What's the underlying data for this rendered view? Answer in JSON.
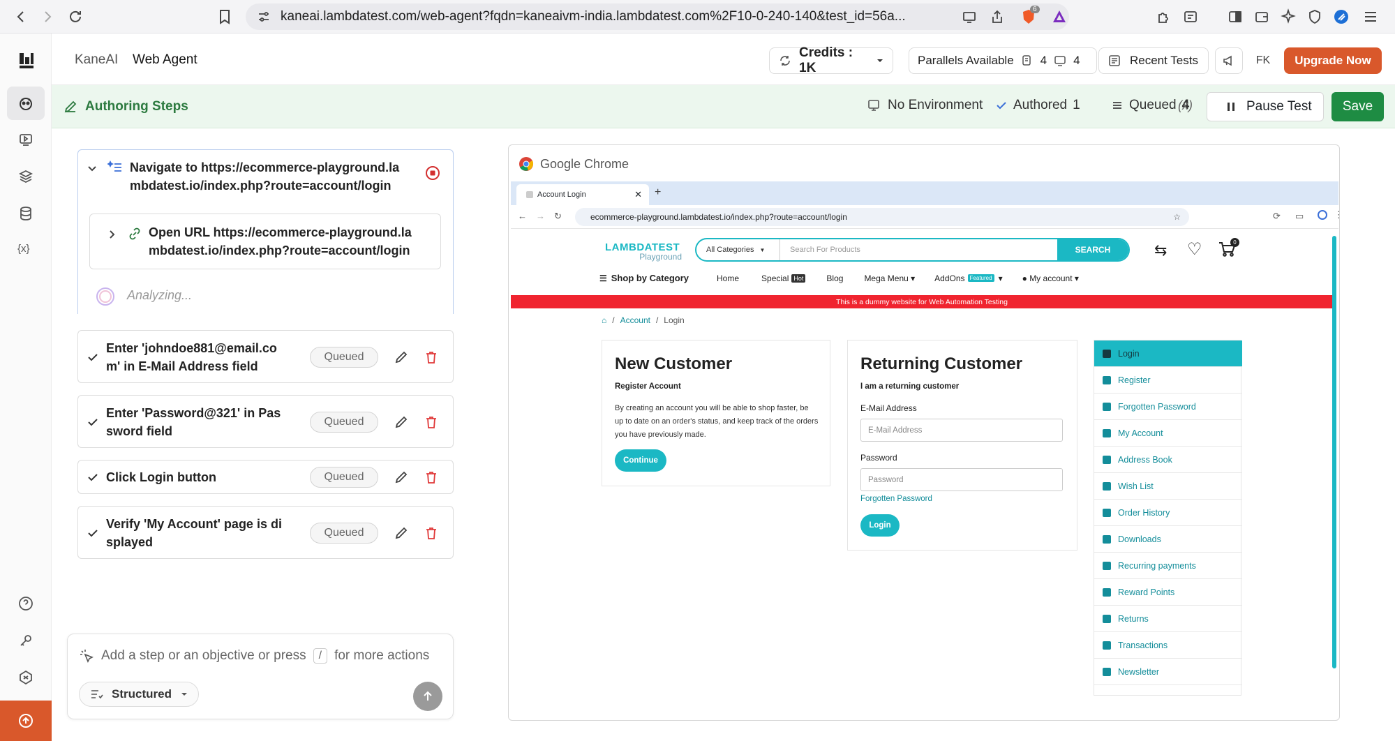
{
  "browser": {
    "url": "kaneai.lambdatest.com/web-agent?fqdn=kaneaivm-india.lambdatest.com%2F10-0-240-140&test_id=56a...",
    "brave_badge": "6"
  },
  "header": {
    "breadcrumb_root": "KaneAI",
    "breadcrumb_current": "Web Agent",
    "credits_label": "Credits : 1K",
    "parallels_label": "Parallels Available",
    "parallels_a": "4",
    "parallels_b": "4",
    "recent_tests": "Recent Tests",
    "avatar_initials": "FK",
    "upgrade_label": "Upgrade Now"
  },
  "authbar": {
    "title": "Authoring Steps",
    "environment": "No Environment",
    "authored_label": "Authored",
    "authored_count": "1",
    "queued_label": "Queued",
    "queued_count": "4",
    "variables_symbol": "(x)",
    "pause_label": "Pause Test",
    "save_label": "Save"
  },
  "steps": {
    "active": {
      "title_line1": "Navigate to https://ecommerce-playground.la",
      "title_line2": "mbdatest.io/index.php?route=account/login",
      "sub_line1": "Open URL https://ecommerce-playground.la",
      "sub_line2": "mbdatest.io/index.php?route=account/login",
      "analyzing": "Analyzing..."
    },
    "queued": [
      {
        "line1": "Enter 'johndoe881@email.co",
        "line2": "m' in E-Mail Address field",
        "status": "Queued"
      },
      {
        "line1": "Enter 'Password@321' in Pas",
        "line2": "sword field",
        "status": "Queued"
      },
      {
        "line1": "Click Login button",
        "line2": "",
        "status": "Queued"
      },
      {
        "line1": "Verify 'My Account' page is di",
        "line2": "splayed",
        "status": "Queued"
      }
    ]
  },
  "chat": {
    "placeholder_a": "Add a step or an objective or press",
    "slash": "/",
    "placeholder_b": "for more actions",
    "mode": "Structured"
  },
  "embed": {
    "window_title": "Google Chrome",
    "tab_title": "Account Login",
    "url": "ecommerce-playground.lambdatest.io/index.php?route=account/login",
    "site": {
      "logo_top": "LAMBDATEST",
      "logo_bottom": "Playground",
      "categories": "All Categories",
      "search_placeholder": "Search For Products",
      "search_button": "SEARCH",
      "cart_count": "0",
      "shop_by_category": "Shop by Category",
      "menu": [
        "Home",
        "Special",
        "Blog",
        "Mega Menu",
        "AddOns",
        "My account"
      ],
      "hot_badge": "Hot",
      "featured_badge": "Featured",
      "banner": "This is a dummy website for Web Automation Testing",
      "breadcrumb": [
        "Account",
        "Login"
      ],
      "new_customer": {
        "title": "New Customer",
        "subtitle": "Register Account",
        "body": "By creating an account you will be able to shop faster, be up to date on an order's status, and keep track of the orders you have previously made.",
        "button": "Continue"
      },
      "returning": {
        "title": "Returning Customer",
        "subtitle": "I am a returning customer",
        "email_label": "E-Mail Address",
        "email_placeholder": "E-Mail Address",
        "password_label": "Password",
        "password_placeholder": "Password",
        "forgotten": "Forgotten Password",
        "button": "Login"
      },
      "side_menu": [
        "Login",
        "Register",
        "Forgotten Password",
        "My Account",
        "Address Book",
        "Wish List",
        "Order History",
        "Downloads",
        "Recurring payments",
        "Reward Points",
        "Returns",
        "Transactions",
        "Newsletter"
      ]
    }
  },
  "colors": {
    "accent_orange": "#d9582b",
    "save_green": "#1e8c43",
    "site_teal": "#1bb8c4",
    "banner_red": "#f0242f"
  }
}
